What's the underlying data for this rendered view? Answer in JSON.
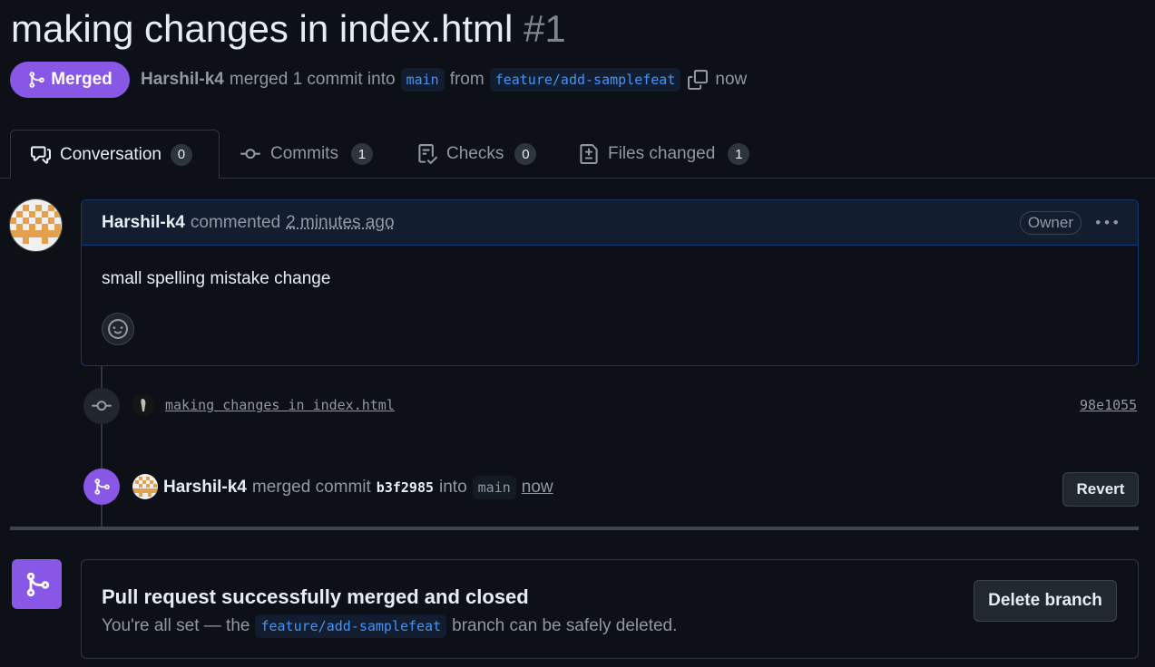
{
  "pr": {
    "title": "making changes in index.html",
    "number": "#1",
    "status": "Merged",
    "author": "Harshil-k4",
    "merge_text": "merged 1 commit into",
    "base_branch": "main",
    "from_text": "from",
    "head_branch": "feature/add-samplefeat",
    "time": "now"
  },
  "tabs": [
    {
      "label": "Conversation",
      "count": "0"
    },
    {
      "label": "Commits",
      "count": "1"
    },
    {
      "label": "Checks",
      "count": "0"
    },
    {
      "label": "Files changed",
      "count": "1"
    }
  ],
  "comment": {
    "author": "Harshil-k4",
    "action": "commented",
    "time": "2 minutes ago",
    "role": "Owner",
    "body": "small spelling mistake change"
  },
  "timeline": {
    "commit_message": "making changes in index.html",
    "commit_sha": "98e1055",
    "merge_author": "Harshil-k4",
    "merge_action": "merged commit",
    "merge_sha": "b3f2985",
    "merge_into": "into",
    "merge_branch": "main",
    "merge_time": "now",
    "revert_label": "Revert"
  },
  "final": {
    "title": "Pull request successfully merged and closed",
    "sub_prefix": "You're all set — the",
    "branch": "feature/add-samplefeat",
    "sub_suffix": "branch can be safely deleted.",
    "delete_label": "Delete branch"
  },
  "colors": {
    "background": "#0d1117",
    "merged_purple": "#8957e5",
    "link_blue": "#4493f8"
  },
  "icons": [
    "git-merge-icon",
    "copy-icon",
    "comment-discussion-icon",
    "git-commit-icon",
    "checklist-icon",
    "file-diff-icon",
    "kebab-horizontal-icon",
    "smiley-icon"
  ]
}
